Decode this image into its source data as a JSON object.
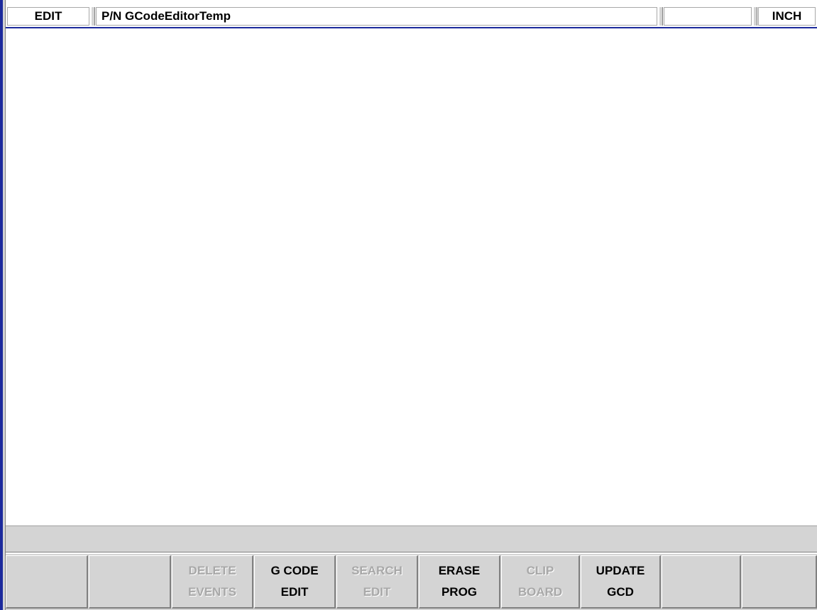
{
  "header": {
    "mode": "EDIT",
    "part_number": "P/N GCodeEditorTemp",
    "blank_field": "",
    "units": "INCH"
  },
  "message_bar": {
    "text": ""
  },
  "softkeys": [
    {
      "line1": "",
      "line2": "",
      "enabled": false
    },
    {
      "line1": "",
      "line2": "",
      "enabled": false
    },
    {
      "line1": "DELETE",
      "line2": "EVENTS",
      "enabled": false
    },
    {
      "line1": "G CODE",
      "line2": "EDIT",
      "enabled": true
    },
    {
      "line1": "SEARCH",
      "line2": "EDIT",
      "enabled": false
    },
    {
      "line1": "ERASE",
      "line2": "PROG",
      "enabled": true
    },
    {
      "line1": "CLIP",
      "line2": "BOARD",
      "enabled": false
    },
    {
      "line1": "UPDATE",
      "line2": "GCD",
      "enabled": true
    },
    {
      "line1": "",
      "line2": "",
      "enabled": false
    },
    {
      "line1": "",
      "line2": "",
      "enabled": false
    }
  ],
  "colors": {
    "frame_blue": "#1c2a9c",
    "panel_gray": "#d4d4d4",
    "disabled_text": "#a8a8a8"
  }
}
